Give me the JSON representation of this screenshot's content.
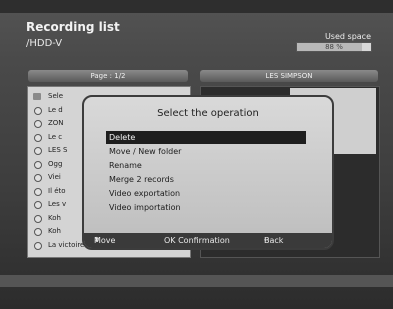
{
  "header": {
    "title": "Recording list",
    "path": "/HDD-V",
    "used_space_label": "Used space",
    "used_space_value": "88 %",
    "used_space_fraction": 0.88
  },
  "columns": {
    "left_header": "Page : 1/2",
    "right_header": "LES SIMPSON"
  },
  "list": {
    "items": [
      {
        "label": "Sele",
        "icon": "folder-icon"
      },
      {
        "label": "Le d",
        "icon": "recording-icon"
      },
      {
        "label": "ZON",
        "icon": "recording-icon"
      },
      {
        "label": "Le c",
        "icon": "recording-icon"
      },
      {
        "label": "LES S",
        "icon": "recording-icon"
      },
      {
        "label": "Ogg",
        "icon": "recording-icon"
      },
      {
        "label": "Viei",
        "icon": "recording-icon"
      },
      {
        "label": "Il éto",
        "icon": "recording-icon"
      },
      {
        "label": "Les v",
        "icon": "recording-icon"
      },
      {
        "label": "Koh",
        "icon": "recording-icon"
      },
      {
        "label": "Koh",
        "icon": "recording-icon"
      },
      {
        "label": "La victoire des vaincus",
        "icon": "recording-icon"
      }
    ]
  },
  "dialog": {
    "title": "Select the operation",
    "options": [
      {
        "label": "Delete",
        "selected": true
      },
      {
        "label": "Move / New folder",
        "selected": false
      },
      {
        "label": "Rename",
        "selected": false
      },
      {
        "label": "Merge 2 records",
        "selected": false
      },
      {
        "label": "Video exportation",
        "selected": false
      },
      {
        "label": "Video importation",
        "selected": false
      }
    ],
    "footer": {
      "move": "Move",
      "ok": "OK Confirmation",
      "back": "Back"
    }
  }
}
